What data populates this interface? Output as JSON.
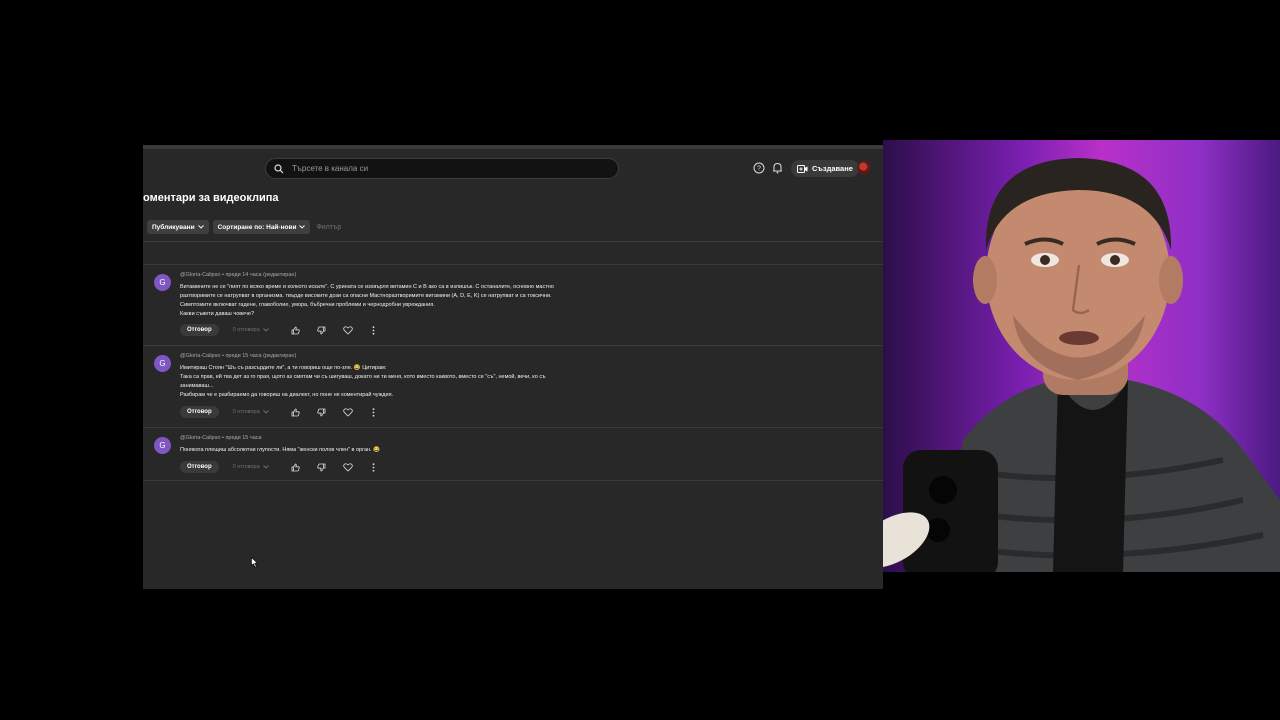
{
  "header": {
    "search_placeholder": "Търсете в канала си",
    "create_label": "Създаване",
    "icons": [
      "search-icon",
      "help-icon",
      "bell-icon",
      "camera-plus-icon"
    ]
  },
  "page": {
    "title": "оментари за видеоклипа"
  },
  "filters": {
    "published_label": "Публикувани",
    "sort_label": "Сортиране по: Най-нови",
    "filter_label": "Филтър"
  },
  "comments": [
    {
      "avatar_letter": "G",
      "author": "@Gloria-Calipso",
      "time": "преди 14 часа (редактиран)",
      "lines": [
        "Витамините не се \"пият по всяко време и колкото искате\". С урината се изхвърля витамин С и В ако са в излишък. С останалите, основно мастно",
        "разтворимите се натрупват в организма. твърде високите дози са опасни Мастноразтворимите витамини (A, D, E, K) се натрупват и са токсични.",
        "Симптомите включват гадене, главоболие, умора, бъбречни проблеми и чернодробни увреждания.",
        "Какви съвети даваш човече?"
      ],
      "reply_label": "Отговор",
      "replies_label": "0 отговора"
    },
    {
      "avatar_letter": "G",
      "author": "@Gloria-Calipso",
      "time": "преди 15 часа (редактиран)",
      "lines": [
        "Имитираш Стоян \"Шъ съ разсърдите ли\", а ти говориш още по-зле. 😂 Цитирам:",
        "Така са прав, ей тва дет аз го прая, щото аз смятам чи съ шигуваш, докато ни ти меня, кото вместо каквото, вместо се \"съ\", немой, вечи, ко съ",
        "занимаваш...",
        "Разбирам че е разбираемо да говориш на диалект, но поне не коментирай чуждия."
      ],
      "reply_label": "Отговор",
      "replies_label": "0 отговора"
    },
    {
      "avatar_letter": "G",
      "author": "@Gloria-Calipso",
      "time": "преди 15 часа",
      "lines": [
        "Понякога плещиш абсолютни глупости. Няма \"женски полов член\" в орган. 😂"
      ],
      "reply_label": "Отговор",
      "replies_label": "0 отговора"
    }
  ],
  "colors": {
    "panel_bg": "#282828",
    "avatar_bg": "#7e57c2",
    "webcam_accent": "#b830c8"
  }
}
